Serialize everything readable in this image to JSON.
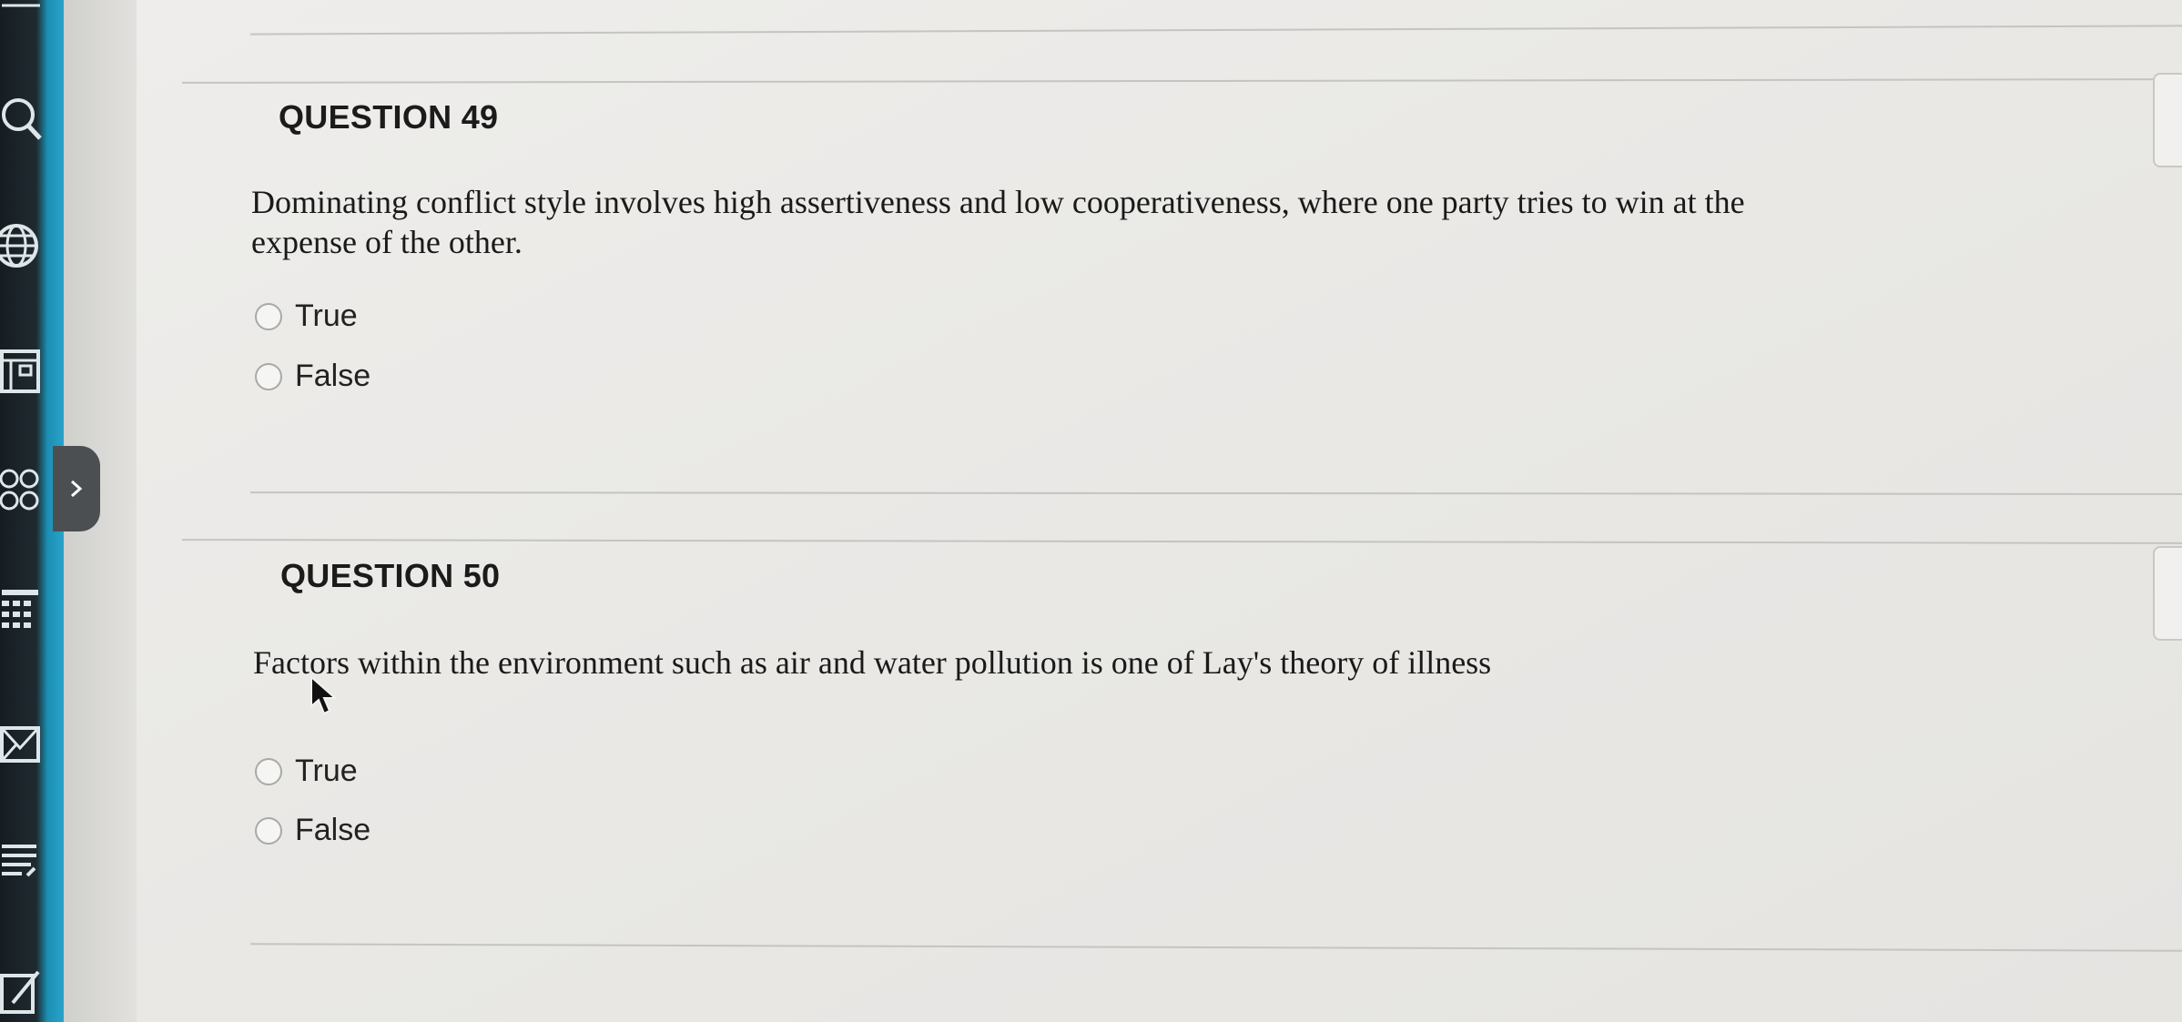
{
  "sidebar": {
    "icons": [
      "search-icon",
      "globe-icon",
      "document-icon",
      "group-icon",
      "calendar-icon",
      "mail-icon",
      "list-icon",
      "edit-icon"
    ]
  },
  "questions": [
    {
      "heading": "QUESTION 49",
      "text_line1": "Dominating conflict style involves high assertiveness and low cooperativeness, where one party tries to win at the",
      "text_line2": "expense of the other.",
      "options": [
        "True",
        "False"
      ]
    },
    {
      "heading": "QUESTION 50",
      "text_line1": "Factors within the environment such as air and water pollution is one of Lay's theory of illness",
      "options": [
        "True",
        "False"
      ]
    }
  ],
  "colors": {
    "sidebar_dark": "#1f2a30",
    "sidebar_accent": "#2aa3c9",
    "background": "#e9e8e5"
  }
}
